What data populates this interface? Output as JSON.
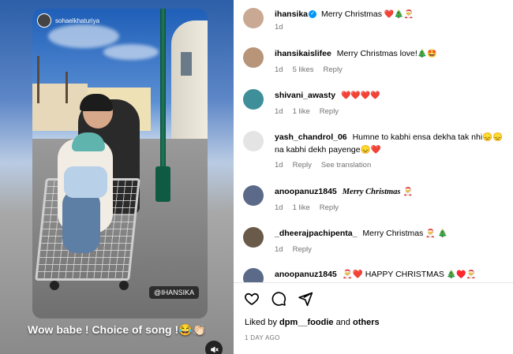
{
  "story": {
    "username": "sohaelkhaturiya",
    "tag": "@IHANSIKA",
    "caption": "Wow babe ! Choice of song !😂👏🏻"
  },
  "comments": [
    {
      "user": "ihansika",
      "verified": true,
      "text": "Merry Christmas",
      "emoji": "❤️🎄🎅",
      "time": "1d",
      "likes": "",
      "actions": [],
      "avatar_color": "#c9a993"
    },
    {
      "user": "ihansikaislifee",
      "verified": false,
      "text": "Merry Christmas love!",
      "emoji": "🎄🤩",
      "time": "1d",
      "likes": "5 likes",
      "actions": [
        "Reply"
      ],
      "avatar_color": "#b89478"
    },
    {
      "user": "shivani_awasty",
      "verified": false,
      "text": "",
      "emoji": "❤️❤️❤️❤️",
      "time": "1d",
      "likes": "1 like",
      "actions": [
        "Reply"
      ],
      "avatar_color": "#3e8f9a"
    },
    {
      "user": "yash_chandrol_06",
      "verified": false,
      "text": "Humne to kabhi ensa dekha tak nhi😞😞 na kabhi dekh payenge😞❤️",
      "emoji": "",
      "time": "1d",
      "likes": "",
      "actions": [
        "Reply",
        "See translation"
      ],
      "avatar_color": "#e4e4e4"
    },
    {
      "user": "anoopanuz1845",
      "verified": false,
      "text": "Merry Christmas",
      "emoji": "🎅",
      "time": "1d",
      "likes": "1 like",
      "actions": [
        "Reply"
      ],
      "avatar_color": "#5a6a88"
    },
    {
      "user": "_dheerajpachipenta_",
      "verified": false,
      "text": "Merry Christmas",
      "emoji": "🎅 🎄",
      "time": "1d",
      "likes": "",
      "actions": [
        "Reply"
      ],
      "avatar_color": "#6a5a4a"
    },
    {
      "user": "anoopanuz1845",
      "verified": false,
      "text": "🎅❤️ HAPPY CHRISTMAS",
      "emoji": "🎄♥️🎅",
      "time": "",
      "likes": "",
      "actions": [],
      "avatar_color": "#5a6a88"
    }
  ],
  "footer": {
    "liked_prefix": "Liked by",
    "liked_user": "dpm__foodie",
    "liked_and": "and",
    "liked_others": "others",
    "date": "1 DAY AGO"
  },
  "icons": {
    "heart": "heart-icon",
    "comment": "comment-icon",
    "share": "share-icon",
    "mute": "mute-icon"
  },
  "colors": {
    "verified": "#0095f6",
    "meta_text": "#737373",
    "heart": "#e0242a"
  }
}
